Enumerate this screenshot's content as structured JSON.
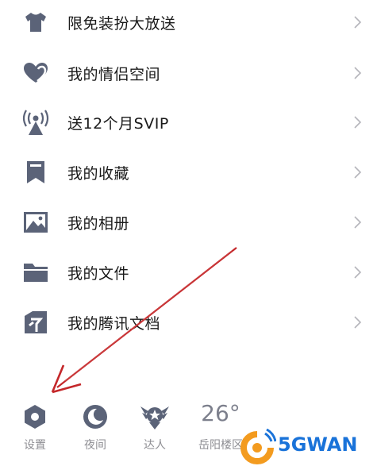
{
  "menu": {
    "items": [
      {
        "label": "限免装扮大放送",
        "icon": "tshirt-icon"
      },
      {
        "label": "我的情侣空间",
        "icon": "hearts-icon"
      },
      {
        "label": "送12个月SVIP",
        "icon": "broadcast-icon"
      },
      {
        "label": "我的收藏",
        "icon": "bookmark-icon"
      },
      {
        "label": "我的相册",
        "icon": "photo-icon"
      },
      {
        "label": "我的文件",
        "icon": "folder-icon"
      },
      {
        "label": "我的腾讯文档",
        "icon": "docs-icon"
      }
    ]
  },
  "bottom_bar": {
    "settings": {
      "label": "设置",
      "icon": "settings-icon"
    },
    "night": {
      "label": "夜间",
      "icon": "moon-icon"
    },
    "expert": {
      "label": "达人",
      "icon": "badge-icon"
    },
    "weather": {
      "temperature": "26°",
      "location": "岳阳楼区"
    }
  },
  "watermark": {
    "text": "5GWAN"
  },
  "colors": {
    "icon": "#5b6378",
    "arrow": "#c4272a",
    "watermark_blue": "#1a73d9",
    "watermark_orange": "#f39b1f"
  }
}
